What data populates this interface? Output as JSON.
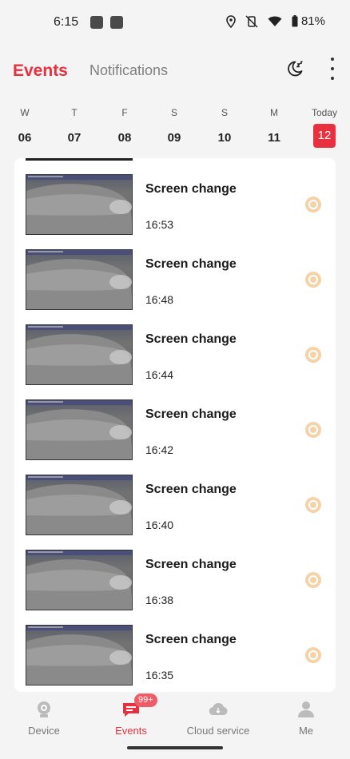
{
  "status_bar": {
    "time": "6:15",
    "battery": "81%"
  },
  "header": {
    "tabs": [
      {
        "label": "Events",
        "active": true
      },
      {
        "label": "Notifications",
        "active": false
      }
    ]
  },
  "calendar": {
    "days": [
      {
        "dow": "W",
        "date": "06"
      },
      {
        "dow": "T",
        "date": "07"
      },
      {
        "dow": "F",
        "date": "08"
      },
      {
        "dow": "S",
        "date": "09"
      },
      {
        "dow": "S",
        "date": "10"
      },
      {
        "dow": "M",
        "date": "11"
      },
      {
        "dow": "Today",
        "date": "12",
        "today": true
      }
    ]
  },
  "events": [
    {
      "title": "Screen change",
      "time": "16:53"
    },
    {
      "title": "Screen change",
      "time": "16:48"
    },
    {
      "title": "Screen change",
      "time": "16:44"
    },
    {
      "title": "Screen change",
      "time": "16:42"
    },
    {
      "title": "Screen change",
      "time": "16:40"
    },
    {
      "title": "Screen change",
      "time": "16:38"
    },
    {
      "title": "Screen change",
      "time": "16:35"
    }
  ],
  "bottom_nav": {
    "items": [
      {
        "label": "Device",
        "icon": "camera-icon",
        "active": false
      },
      {
        "label": "Events",
        "icon": "events-icon",
        "active": true,
        "badge": "99+"
      },
      {
        "label": "Cloud service",
        "icon": "cloud-icon",
        "active": false
      },
      {
        "label": "Me",
        "icon": "person-icon",
        "active": false
      }
    ]
  },
  "colors": {
    "accent": "#e8303f",
    "event_icon": "#f5d3a8"
  }
}
